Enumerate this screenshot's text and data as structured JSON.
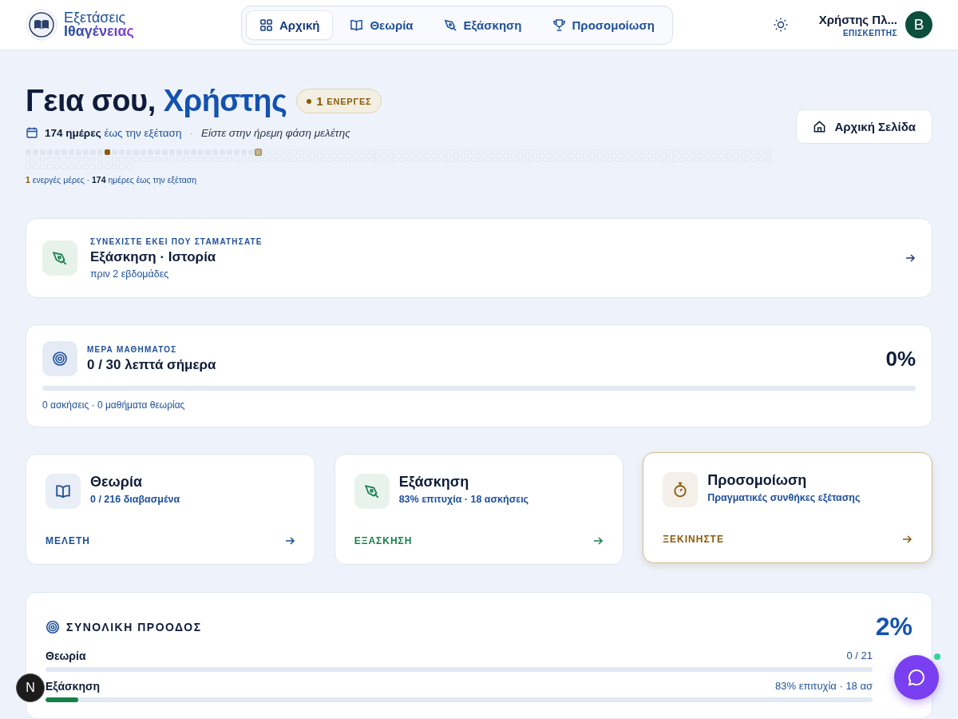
{
  "header": {
    "logo": {
      "line1": "Εξετάσεις",
      "line2": "Ιθαγένειας"
    },
    "nav": [
      {
        "label": "Αρχική",
        "kind": "grid",
        "selected": true
      },
      {
        "label": "Θεωρία",
        "kind": "book",
        "selected": false
      },
      {
        "label": "Εξάσκηση",
        "kind": "pen",
        "selected": false
      },
      {
        "label": "Προσομοίωση",
        "kind": "trophy",
        "selected": false
      }
    ],
    "user": {
      "name": "Χρήστης Πλ...",
      "role": "ΕΠΙΣΚΕΠΤΗΣ",
      "initial": "B"
    }
  },
  "greeting": {
    "hello": "Γεια σου,",
    "name": "Χρήστης",
    "badge_count": "1",
    "badge_label": "ΕΝΕΡΓΕΣ",
    "days_count": "174 ημέρες",
    "days_rest": "έως την εξέταση",
    "separator": "·",
    "phase": "Είστε στην ήρεμη φάση μελέτης",
    "home_button": "Αρχική Σελίδα"
  },
  "day_grid": {
    "cells": [
      {
        "kind": "past"
      },
      {
        "kind": "past"
      },
      {
        "kind": "past"
      },
      {
        "kind": "past"
      },
      {
        "kind": "past"
      },
      {
        "kind": "past"
      },
      {
        "kind": "past"
      },
      {
        "kind": "past"
      },
      {
        "kind": "past"
      },
      {
        "kind": "past"
      },
      {
        "kind": "past"
      },
      {
        "kind": "active"
      },
      {
        "kind": "past"
      },
      {
        "kind": "past"
      },
      {
        "kind": "past"
      },
      {
        "kind": "past"
      },
      {
        "kind": "past"
      },
      {
        "kind": "past"
      },
      {
        "kind": "past"
      },
      {
        "kind": "past"
      },
      {
        "kind": "past"
      },
      {
        "kind": "past"
      },
      {
        "kind": "past"
      },
      {
        "kind": "past"
      },
      {
        "kind": "past"
      },
      {
        "kind": "past"
      },
      {
        "kind": "past"
      },
      {
        "kind": "past"
      },
      {
        "kind": "past"
      },
      {
        "kind": "past"
      },
      {
        "kind": "past"
      },
      {
        "kind": "past"
      },
      {
        "kind": "today"
      },
      {
        "kind": "future"
      },
      {
        "kind": "future"
      },
      {
        "kind": "future"
      },
      {
        "kind": "future"
      },
      {
        "kind": "future"
      },
      {
        "kind": "future"
      },
      {
        "kind": "future"
      },
      {
        "kind": "future"
      },
      {
        "kind": "future"
      },
      {
        "kind": "future"
      },
      {
        "kind": "future"
      },
      {
        "kind": "future"
      },
      {
        "kind": "future"
      },
      {
        "kind": "future"
      },
      {
        "kind": "future"
      },
      {
        "kind": "future"
      },
      {
        "kind": "future"
      },
      {
        "kind": "future"
      },
      {
        "kind": "future"
      },
      {
        "kind": "future"
      },
      {
        "kind": "future"
      },
      {
        "kind": "future"
      },
      {
        "kind": "future"
      },
      {
        "kind": "future"
      },
      {
        "kind": "future"
      },
      {
        "kind": "future"
      },
      {
        "kind": "future"
      },
      {
        "kind": "future"
      },
      {
        "kind": "future"
      },
      {
        "kind": "future"
      },
      {
        "kind": "future"
      },
      {
        "kind": "future"
      },
      {
        "kind": "future"
      },
      {
        "kind": "future"
      },
      {
        "kind": "future"
      },
      {
        "kind": "future"
      },
      {
        "kind": "future"
      },
      {
        "kind": "future"
      },
      {
        "kind": "future"
      },
      {
        "kind": "future"
      },
      {
        "kind": "future"
      },
      {
        "kind": "future"
      },
      {
        "kind": "future"
      },
      {
        "kind": "future"
      },
      {
        "kind": "future"
      },
      {
        "kind": "future"
      },
      {
        "kind": "future"
      },
      {
        "kind": "future"
      },
      {
        "kind": "future"
      },
      {
        "kind": "future"
      },
      {
        "kind": "future"
      },
      {
        "kind": "future"
      },
      {
        "kind": "future"
      },
      {
        "kind": "future"
      },
      {
        "kind": "future"
      },
      {
        "kind": "future"
      },
      {
        "kind": "future"
      },
      {
        "kind": "future"
      },
      {
        "kind": "future"
      },
      {
        "kind": "future"
      },
      {
        "kind": "future"
      },
      {
        "kind": "future"
      },
      {
        "kind": "future"
      },
      {
        "kind": "future"
      },
      {
        "kind": "future"
      },
      {
        "kind": "future"
      },
      {
        "kind": "future"
      },
      {
        "kind": "future"
      },
      {
        "kind": "future"
      },
      {
        "kind": "future"
      },
      {
        "kind": "future"
      },
      {
        "kind": "future"
      },
      {
        "kind": "future"
      },
      {
        "kind": "future"
      },
      {
        "kind": "future"
      },
      {
        "kind": "future"
      },
      {
        "kind": "future"
      },
      {
        "kind": "future"
      },
      {
        "kind": "future"
      },
      {
        "kind": "future"
      },
      {
        "kind": "future"
      },
      {
        "kind": "future"
      },
      {
        "kind": "future"
      },
      {
        "kind": "future"
      },
      {
        "kind": "future"
      },
      {
        "kind": "future"
      },
      {
        "kind": "future"
      },
      {
        "kind": "future"
      },
      {
        "kind": "future"
      },
      {
        "kind": "future"
      },
      {
        "kind": "future"
      },
      {
        "kind": "future"
      },
      {
        "kind": "future"
      },
      {
        "kind": "future"
      },
      {
        "kind": "future"
      },
      {
        "kind": "future"
      },
      {
        "kind": "future"
      },
      {
        "kind": "future"
      },
      {
        "kind": "future"
      },
      {
        "kind": "future"
      },
      {
        "kind": "future"
      },
      {
        "kind": "future"
      },
      {
        "kind": "future"
      },
      {
        "kind": "future"
      },
      {
        "kind": "future"
      },
      {
        "kind": "future"
      },
      {
        "kind": "future"
      },
      {
        "kind": "future"
      },
      {
        "kind": "future"
      },
      {
        "kind": "future"
      },
      {
        "kind": "future"
      },
      {
        "kind": "future"
      },
      {
        "kind": "future"
      },
      {
        "kind": "future"
      },
      {
        "kind": "future"
      },
      {
        "kind": "future"
      },
      {
        "kind": "future"
      },
      {
        "kind": "future"
      },
      {
        "kind": "future"
      },
      {
        "kind": "future"
      },
      {
        "kind": "future"
      },
      {
        "kind": "future"
      },
      {
        "kind": "future"
      },
      {
        "kind": "future"
      },
      {
        "kind": "future"
      },
      {
        "kind": "future"
      },
      {
        "kind": "future"
      },
      {
        "kind": "future"
      },
      {
        "kind": "future"
      },
      {
        "kind": "future"
      },
      {
        "kind": "future"
      },
      {
        "kind": "future"
      },
      {
        "kind": "future"
      },
      {
        "kind": "future"
      },
      {
        "kind": "future"
      },
      {
        "kind": "future"
      },
      {
        "kind": "future"
      },
      {
        "kind": "future"
      },
      {
        "kind": "future"
      },
      {
        "kind": "future"
      },
      {
        "kind": "future"
      },
      {
        "kind": "future"
      },
      {
        "kind": "future"
      },
      {
        "kind": "future"
      },
      {
        "kind": "future"
      },
      {
        "kind": "future"
      },
      {
        "kind": "future"
      },
      {
        "kind": "future"
      },
      {
        "kind": "future"
      },
      {
        "kind": "future"
      },
      {
        "kind": "future"
      },
      {
        "kind": "future"
      },
      {
        "kind": "future"
      },
      {
        "kind": "future"
      },
      {
        "kind": "future"
      },
      {
        "kind": "future"
      },
      {
        "kind": "future"
      },
      {
        "kind": "future"
      },
      {
        "kind": "future"
      },
      {
        "kind": "future"
      },
      {
        "kind": "future"
      },
      {
        "kind": "future"
      },
      {
        "kind": "future"
      },
      {
        "kind": "future"
      },
      {
        "kind": "future"
      },
      {
        "kind": "future"
      },
      {
        "kind": "future"
      },
      {
        "kind": "future"
      },
      {
        "kind": "future"
      },
      {
        "kind": "future"
      },
      {
        "kind": "future"
      },
      {
        "kind": "future"
      },
      {
        "kind": "future"
      },
      {
        "kind": "future"
      },
      {
        "kind": "future"
      },
      {
        "kind": "future"
      },
      {
        "kind": "future"
      },
      {
        "kind": "future"
      },
      {
        "kind": "future"
      },
      {
        "kind": "future"
      },
      {
        "kind": "future"
      },
      {
        "kind": "future"
      },
      {
        "kind": "future"
      },
      {
        "kind": "future"
      },
      {
        "kind": "future"
      },
      {
        "kind": "future"
      },
      {
        "kind": "future"
      },
      {
        "kind": "future"
      },
      {
        "kind": "future"
      },
      {
        "kind": "future"
      }
    ],
    "legend_active": "1",
    "legend_active_label": "ενεργές μέρες ·",
    "legend_days": "174",
    "legend_days_label": "ημέρες έως την εξέταση"
  },
  "continue": {
    "eyebrow": "ΣΥΝΕΧΙΣΤΕ ΕΚΕΙ ΠΟΥ ΣΤΑΜΑΤΗΣΑΤΕ",
    "title": "Εξάσκηση · Ιστορία",
    "time": "πριν 2 εβδομάδες"
  },
  "daily": {
    "eyebrow": "ΜΕΡΑ ΜΑΘΗΜΑΤΟΣ",
    "title": "0 / 30 λεπτά σήμερα",
    "percent": "0%",
    "level": 0,
    "summary": "0 ασκήσεις · 0 μαθήματα θεωρίας"
  },
  "modes": [
    {
      "kind": "book",
      "title": "Θεωρία",
      "subtitle": "0 / 216 διαβασμένα",
      "action": "ΜΕΛΕΤΗ",
      "color": "#1e4f9c",
      "featured": false
    },
    {
      "kind": "pen",
      "title": "Εξάσκηση",
      "subtitle": "83% επιτυχία · 18 ασκήσεις",
      "action": "ΕΞΑΣΚΗΣΗ",
      "color": "#17804a",
      "featured": false
    },
    {
      "kind": "timer",
      "title": "Προσομοίωση",
      "subtitle": "Πραγματικές συνθήκες εξέτασης",
      "action": "ΞΕΚΙΝΗΣΤΕ",
      "color": "#8a5a0b",
      "featured": true
    }
  ],
  "overall": {
    "title": "ΣΥΝΟΛΙΚΗ ΠΡΟΟΔΟΣ",
    "percent": "2%",
    "rows": [
      {
        "label": "Θεωρία",
        "value": "0 / 21",
        "level": 0
      },
      {
        "label": "Εξάσκηση",
        "value": "83% επιτυχία · 18 ασ",
        "level": 0.04
      }
    ]
  },
  "dev_badge": "N"
}
